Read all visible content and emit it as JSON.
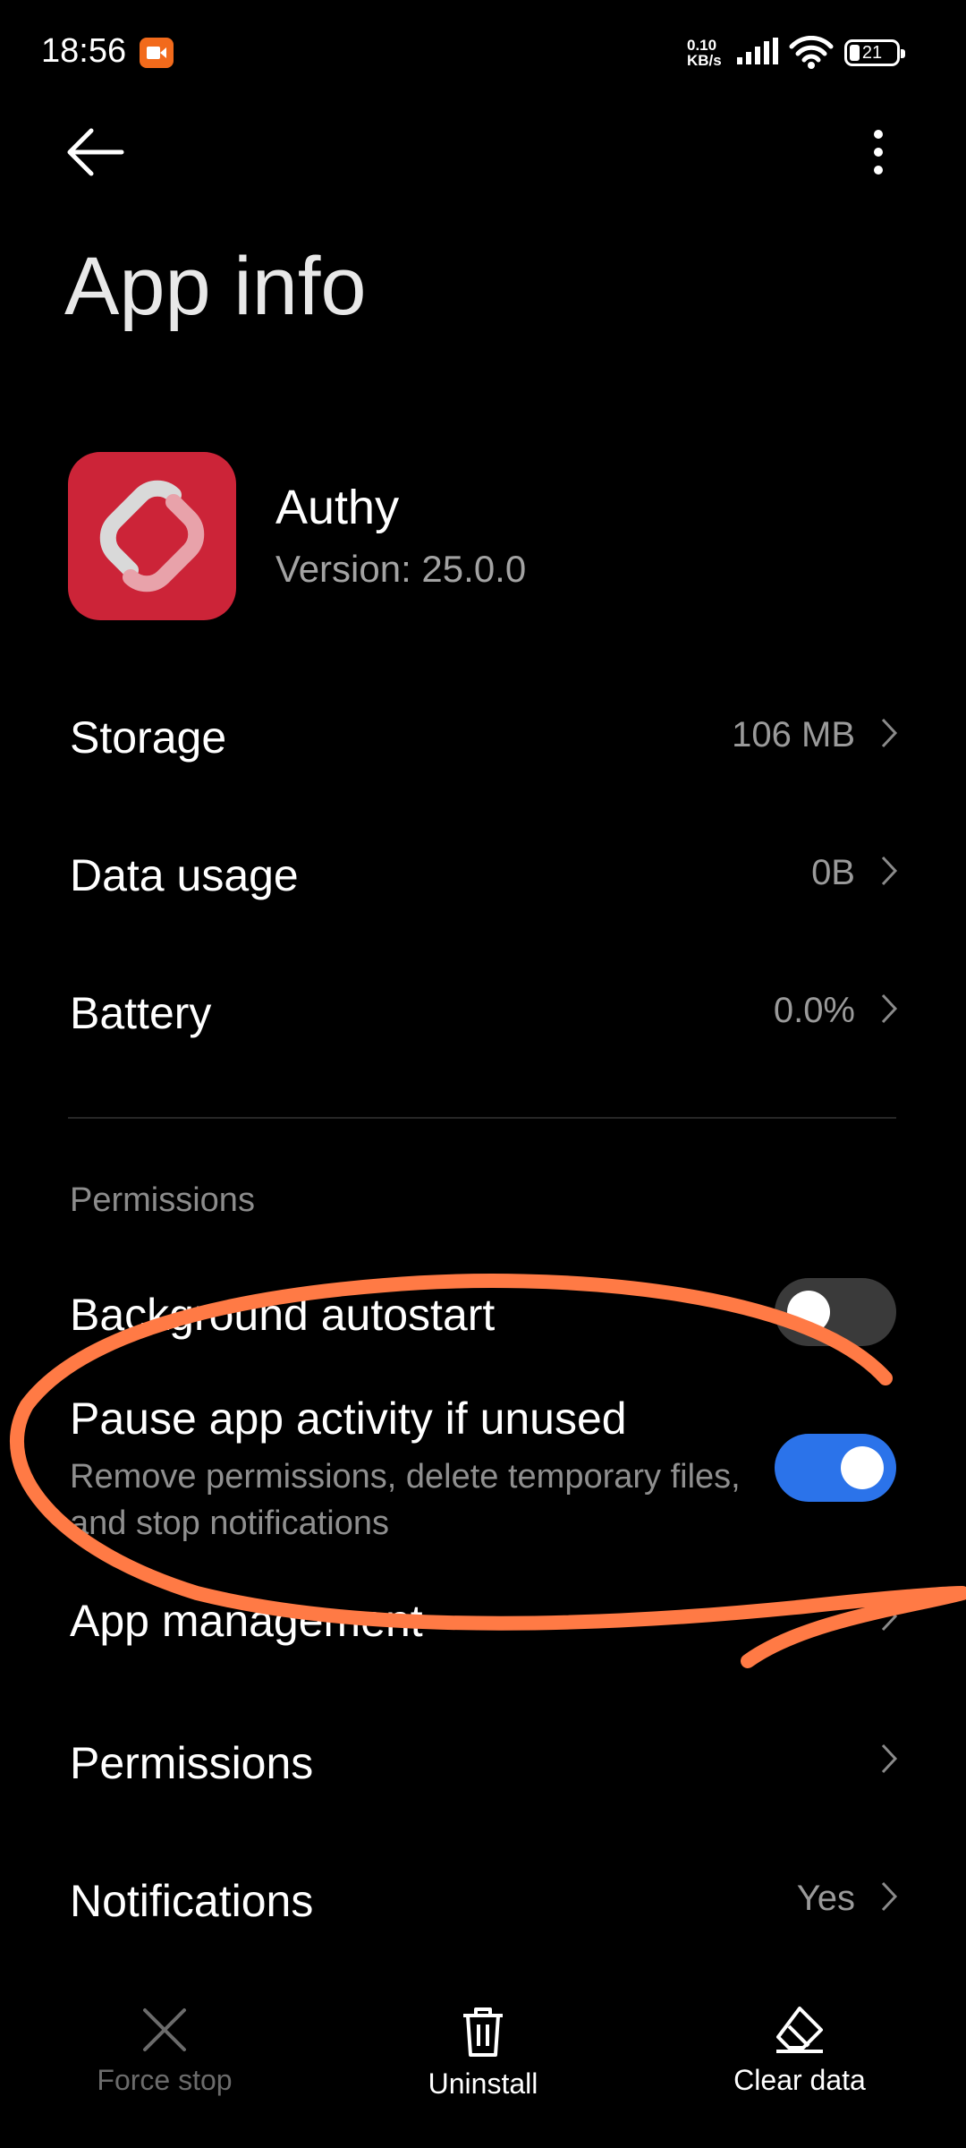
{
  "status_bar": {
    "time": "18:56",
    "net_speed_value": "0.10",
    "net_speed_unit": "KB/s",
    "battery": "21"
  },
  "header": {
    "title": "App info"
  },
  "app": {
    "name": "Authy",
    "version": "Version: 25.0.0",
    "icon_color": "#cc2438"
  },
  "rows": {
    "storage": {
      "label": "Storage",
      "value": "106 MB"
    },
    "data_usage": {
      "label": "Data usage",
      "value": "0B"
    },
    "battery": {
      "label": "Battery",
      "value": "0.0%"
    }
  },
  "permissions_section": {
    "title": "Permissions",
    "background_autostart": {
      "label": "Background autostart",
      "enabled": false
    },
    "pause_app": {
      "label": "Pause app activity if unused",
      "description": "Remove permissions, delete temporary files, and stop notifications",
      "enabled": true
    },
    "app_management": {
      "label": "App management"
    },
    "permissions": {
      "label": "Permissions"
    },
    "notifications": {
      "label": "Notifications",
      "value": "Yes"
    }
  },
  "bottom_bar": {
    "force_stop": "Force stop",
    "uninstall": "Uninstall",
    "clear_data": "Clear data"
  },
  "colors": {
    "background": "#000000",
    "toggle_on": "#2b73ea",
    "annotation": "#ff7a45"
  }
}
